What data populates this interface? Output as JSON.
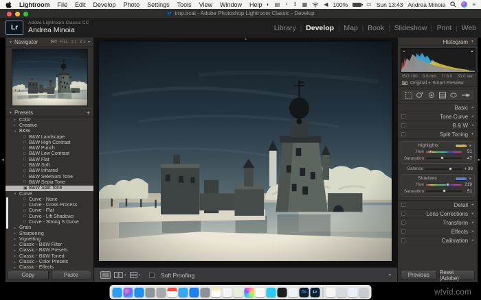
{
  "icons": {
    "tri_down": "▼",
    "tri_right_sm": "▸",
    "tri_down_sm": "▾",
    "collapse_left": "◄",
    "collapse_right": "►",
    "up_arrow": "▲",
    "plus": "+",
    "square": "□",
    "square_sel": "▣",
    "dropdown": "▾",
    "menu_lines": "≡",
    "dnd": "◐",
    "display": "▤",
    "clock": "◔",
    "upload": "↥",
    "keyboard": "▦",
    "volume": "◀"
  },
  "menu_bar": {
    "menus": [
      "Lightroom",
      "File",
      "Edit",
      "Develop",
      "Photo",
      "Settings",
      "Tools",
      "View",
      "Window",
      "Help"
    ],
    "status": {
      "battery": "100%",
      "clock": "Sun 13:43",
      "user": "Andrea Minoia"
    }
  },
  "title_bar": {
    "badge": "Lr",
    "title": "tmp.lrcat - Adobe Photoshop Lightroom Classic - Develop"
  },
  "header": {
    "logo": "Lr",
    "app_name": "Adobe Lightroom Classic CC",
    "user_name": "Andrea Minoia",
    "module_separator": "|",
    "modules": [
      {
        "label": "Library"
      },
      {
        "label": "Develop",
        "active": true
      },
      {
        "label": "Map"
      },
      {
        "label": "Book"
      },
      {
        "label": "Slideshow"
      },
      {
        "label": "Print"
      },
      {
        "label": "Web"
      }
    ]
  },
  "left_panel": {
    "navigator": {
      "title": "Navigator",
      "zoom_options": [
        "FIT",
        "FILL",
        "1:1",
        "3:1"
      ]
    },
    "presets": {
      "title": "Presets",
      "add": "+",
      "items": [
        {
          "type": "group",
          "state": "collapsed",
          "label": "Color"
        },
        {
          "type": "group",
          "state": "collapsed",
          "label": "Creative"
        },
        {
          "type": "group",
          "state": "expanded",
          "label": "B&W"
        },
        {
          "type": "preset",
          "label": "B&W Landscape"
        },
        {
          "type": "preset",
          "label": "B&W High Contrast"
        },
        {
          "type": "preset",
          "label": "B&W Punch"
        },
        {
          "type": "preset",
          "label": "B&W Low Contrast"
        },
        {
          "type": "preset",
          "label": "B&W Flat"
        },
        {
          "type": "preset",
          "label": "B&W Soft"
        },
        {
          "type": "preset",
          "label": "B&W Infrared"
        },
        {
          "type": "preset",
          "label": "B&W Selenium Tone"
        },
        {
          "type": "preset",
          "label": "B&W Sepia Tone"
        },
        {
          "type": "preset",
          "label": "B&W Split Tone",
          "selected": true
        },
        {
          "type": "group",
          "state": "expanded",
          "label": "Curve"
        },
        {
          "type": "preset",
          "label": "Curve - None"
        },
        {
          "type": "preset",
          "label": "Curve - Cross Process"
        },
        {
          "type": "preset",
          "label": "Curve - Flat"
        },
        {
          "type": "preset",
          "label": "Curve - Lift Shadows"
        },
        {
          "type": "preset",
          "label": "Curve - Strong S Curve"
        },
        {
          "type": "group",
          "state": "collapsed",
          "label": "Grain"
        },
        {
          "type": "group",
          "state": "collapsed",
          "label": "Sharpening"
        },
        {
          "type": "group",
          "state": "collapsed",
          "label": "Vignetting"
        },
        {
          "type": "group",
          "state": "collapsed",
          "label": "Classic - B&W Filter"
        },
        {
          "type": "group",
          "state": "collapsed",
          "label": "Classic - B&W Presets"
        },
        {
          "type": "group",
          "state": "collapsed",
          "label": "Classic - B&W Toned"
        },
        {
          "type": "group",
          "state": "collapsed",
          "label": "Classic - Color Presets"
        },
        {
          "type": "group",
          "state": "collapsed",
          "label": "Classic - Effects"
        }
      ]
    },
    "copy": "Copy",
    "paste": "Paste"
  },
  "toolbar": {
    "soft_proofing": "Soft Proofing"
  },
  "right_panel": {
    "histogram": {
      "title": "Histogram",
      "exif": [
        "ISO 100",
        "8.8 mm",
        "f / 8.0",
        "30.0 sec"
      ],
      "preview": "Original + Smart Preview"
    },
    "labels": {
      "basic": "Basic",
      "tone_curve": "Tone Curve",
      "bw": "B & W",
      "split_toning": "Split Toning",
      "detail": "Detail",
      "lens": "Lens Corrections",
      "transform": "Transform",
      "effects": "Effects",
      "calibration": "Calibration"
    },
    "split_toning": {
      "highlights_label": "Highlights",
      "shadows_label": "Shadows",
      "hue_label": "Hue",
      "saturation_label": "Saturation",
      "balance_label": "Balance",
      "highlights_hue": "51",
      "highlights_saturation": "47",
      "balance": "+ 38",
      "shadows_hue": "219",
      "shadows_saturation": "51",
      "highlights_swatch": "#c9ae4a",
      "shadows_swatch": "#5b83c5"
    },
    "previous": "Previous",
    "reset": "Reset (Adobe)"
  },
  "watermark": "wtvid.com",
  "dock": {
    "items": [
      {
        "name": "finder",
        "color": "#2a9df4"
      },
      {
        "name": "siri",
        "color": "#3c3c6e"
      },
      {
        "name": "app-store",
        "color": "#1d8ff0"
      },
      {
        "name": "launchpad",
        "color": "#90959b"
      },
      {
        "name": "system-preferences",
        "color": "#a9a9a9"
      },
      {
        "name": "calendar",
        "color": "#f6f6f6"
      },
      {
        "name": "safari",
        "color": "#36a8f3"
      },
      {
        "name": "mail",
        "color": "#1b80f0"
      },
      {
        "name": "photo-booth",
        "color": "#8d9196"
      },
      {
        "name": "notes",
        "color": "#f7f4e8"
      },
      {
        "name": "textedit",
        "color": "#f4f4f4"
      },
      {
        "name": "maps",
        "color": "#e4eeda"
      },
      {
        "name": "photos",
        "color": "#ffffff"
      },
      {
        "name": "itunes",
        "color": "#fafafa"
      },
      {
        "name": "messages",
        "color": "#29c8f5"
      },
      {
        "name": "terminal",
        "color": "#1d1d1f"
      },
      {
        "name": "dictionary",
        "color": "#f0f3f6"
      },
      {
        "name": "photoshop",
        "color": "#0b2033",
        "label": "Ps"
      },
      {
        "name": "lightroom",
        "color": "#0b2033",
        "label": "Lr"
      },
      {
        "name": "separator"
      },
      {
        "name": "timer",
        "color": "#f5f5f5"
      },
      {
        "name": "documents",
        "color": "#d8dbdf"
      },
      {
        "name": "reminders",
        "color": "#eaf1fb"
      },
      {
        "name": "trash",
        "color": "#c8ccd1"
      }
    ]
  }
}
